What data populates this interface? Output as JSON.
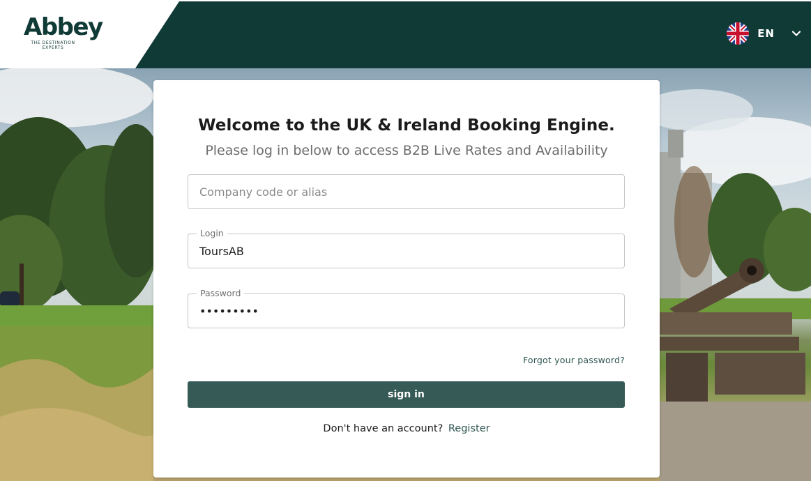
{
  "header": {
    "logo_text": "Abbey",
    "logo_tagline_1": "THE DESTINATION",
    "logo_tagline_2": "EXPERTS",
    "language_code": "EN",
    "language_flag": "uk-flag-icon",
    "brand_color": "#0f3a35"
  },
  "login": {
    "title": "Welcome to the UK & Ireland Booking Engine.",
    "subtitle": "Please log in below to access B2B Live Rates and Availability",
    "company_placeholder": "Company code or alias",
    "company_value": "",
    "login_label": "Login",
    "login_value": "ToursAB",
    "password_label": "Password",
    "password_value": "•••••••••",
    "forgot_link": "Forgot your password?",
    "signin_button": "sign in",
    "register_prompt": "Don't have an account?",
    "register_link": "Register",
    "button_color": "#365a55"
  }
}
